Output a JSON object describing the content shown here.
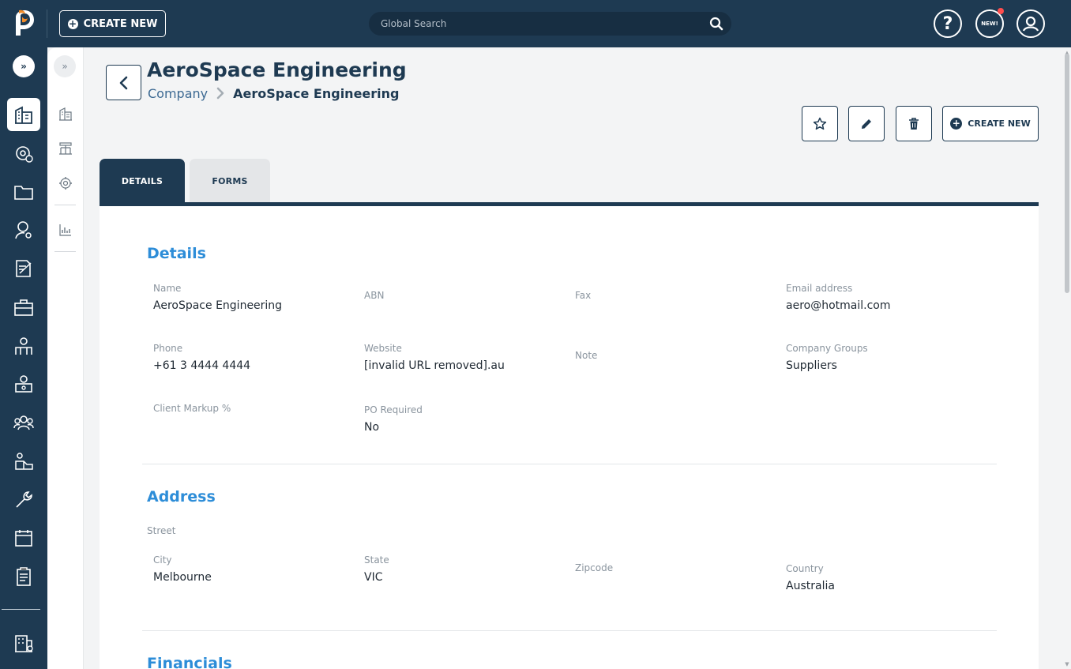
{
  "topbar": {
    "create_label": "CREATE NEW",
    "search_placeholder": "Global Search",
    "news_badge": "NEW!"
  },
  "page": {
    "title": "AeroSpace Engineering",
    "breadcrumb": {
      "parent": "Company",
      "current": "AeroSpace Engineering"
    },
    "actions": {
      "create_label": "CREATE NEW"
    }
  },
  "tabs": [
    {
      "label": "DETAILS",
      "active": true
    },
    {
      "label": "FORMS",
      "active": false
    }
  ],
  "details": {
    "title": "Details",
    "name": {
      "label": "Name",
      "value": "AeroSpace Engineering"
    },
    "abn": {
      "label": "ABN",
      "value": ""
    },
    "fax": {
      "label": "Fax",
      "value": ""
    },
    "email": {
      "label": "Email address",
      "value": "aero@hotmail.com"
    },
    "phone": {
      "label": "Phone",
      "value": "+61 3 4444 4444"
    },
    "website": {
      "label": "Website",
      "value": "[invalid URL removed].au"
    },
    "note": {
      "label": "Note",
      "value": ""
    },
    "company_groups": {
      "label": "Company Groups",
      "value": "Suppliers"
    },
    "client_markup": {
      "label": "Client Markup %",
      "value": ""
    },
    "po_required": {
      "label": "PO Required",
      "value": "No"
    }
  },
  "address": {
    "title": "Address",
    "street": {
      "label": "Street",
      "value": ""
    },
    "city": {
      "label": "City",
      "value": "Melbourne"
    },
    "state": {
      "label": "State",
      "value": "VIC"
    },
    "zipcode": {
      "label": "Zipcode",
      "value": ""
    },
    "country": {
      "label": "Country",
      "value": "Australia"
    }
  },
  "financials": {
    "title": "Financials"
  },
  "colors": {
    "navy": "#1e3a52",
    "accent_blue": "#2d8dd8",
    "logo_orange": "#f28c28",
    "notification_red": "#ff4d4d"
  },
  "icons": {
    "sidebar": [
      "companies-icon",
      "settings-alert-icon",
      "folder-icon",
      "user-gear-icon",
      "contract-icon",
      "briefcase-icon",
      "stakeholders-icon",
      "department-icon",
      "people-icon",
      "warehouse-icon",
      "wrench-icon",
      "calendar-icon",
      "clipboard-icon",
      "reports-icon"
    ],
    "subnav": [
      "building-icon",
      "org-chart-icon",
      "gear-icon",
      "chart-icon"
    ]
  }
}
